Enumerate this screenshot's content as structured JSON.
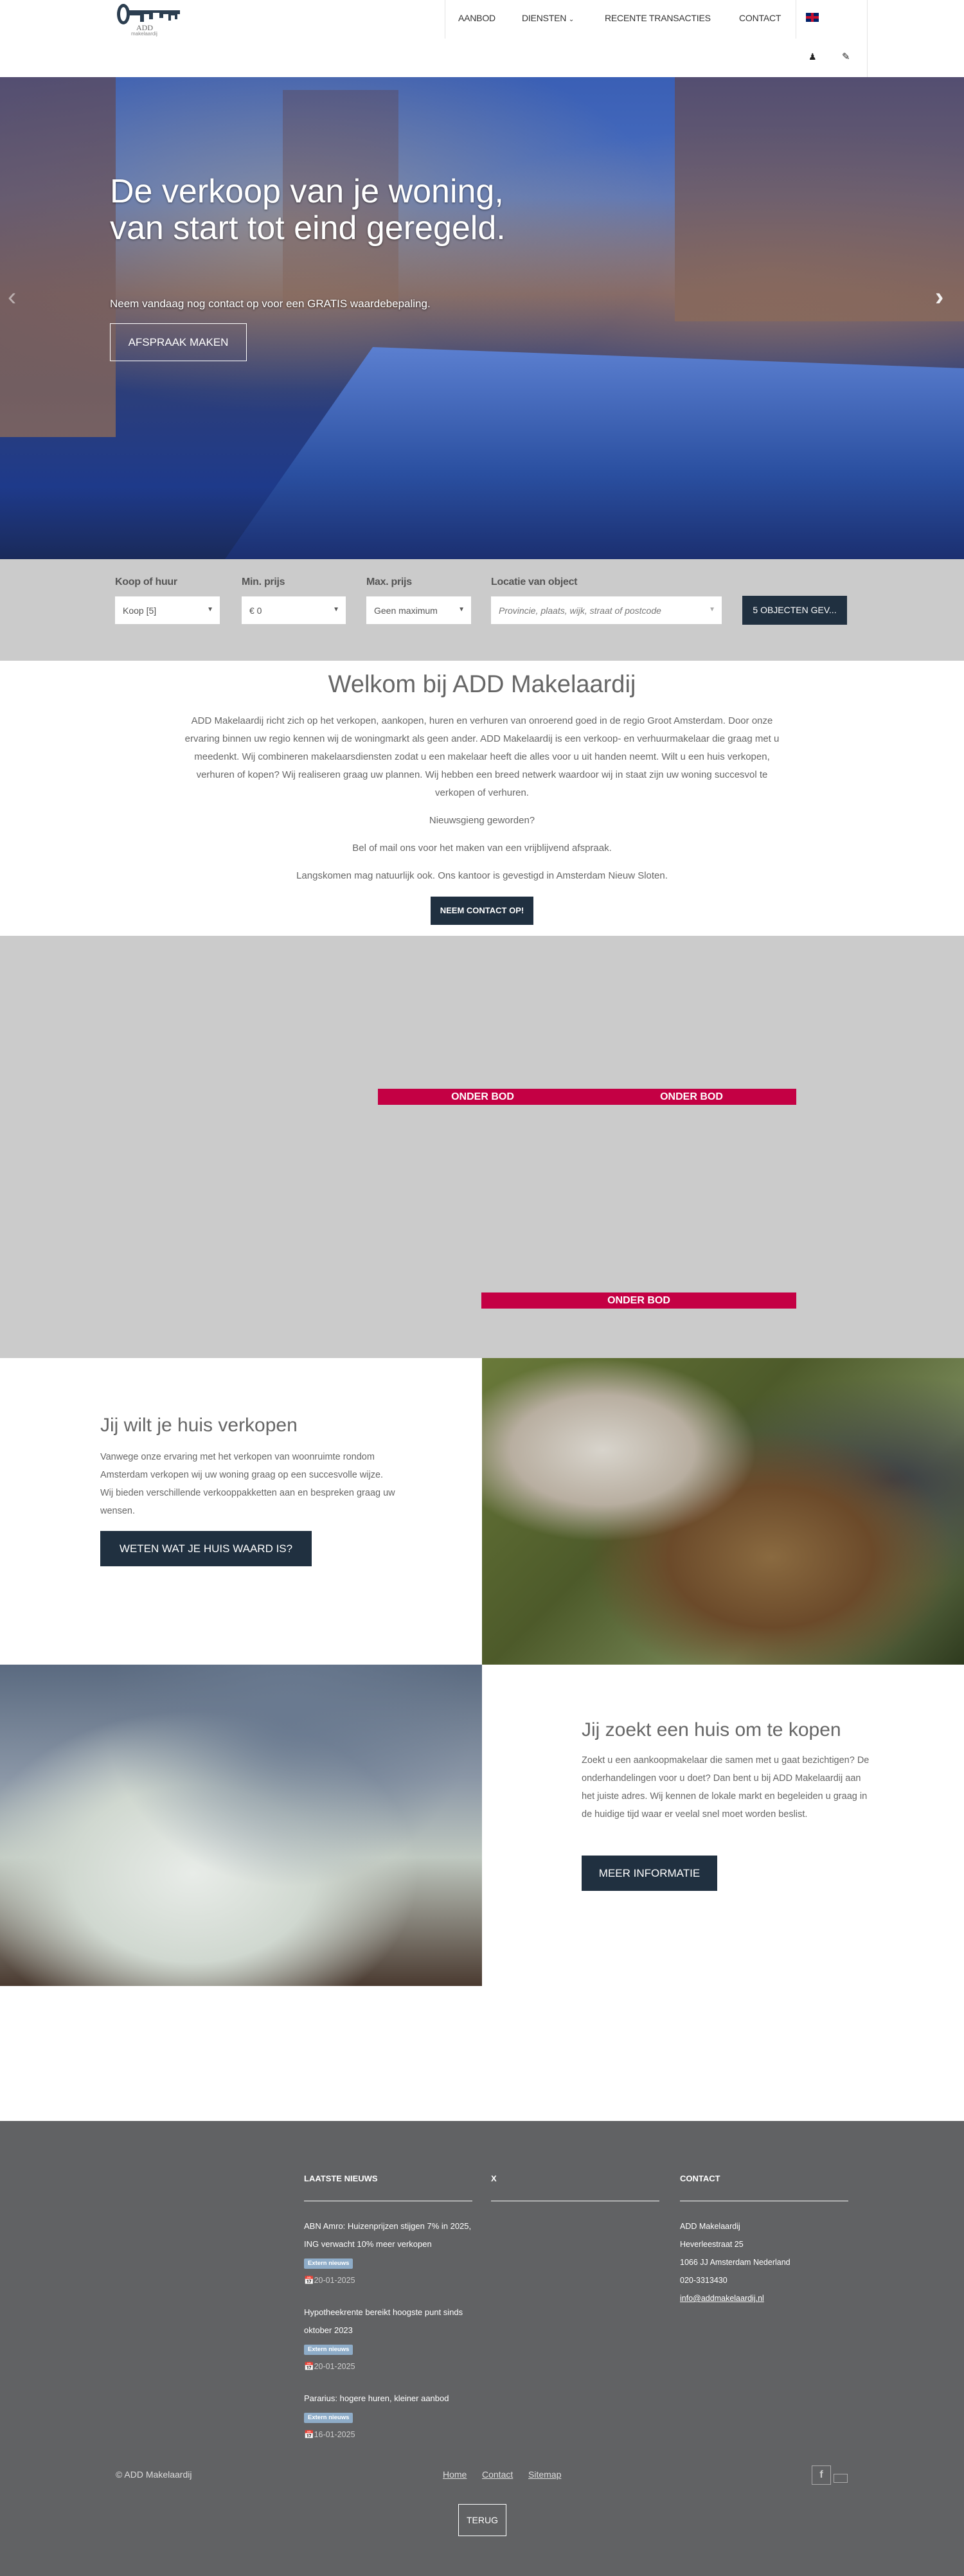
{
  "header": {
    "logo": {
      "text": "ADD",
      "subtext": "makelaardij"
    },
    "nav": [
      {
        "label": "AANBOD"
      },
      {
        "label": "DIENSTEN",
        "icon": "chevron-down-icon"
      },
      {
        "label": "RECENTE TRANSACTIES"
      },
      {
        "label": "CONTACT"
      }
    ],
    "language_icon": "uk-flag-icon",
    "user_icon": "user-icon",
    "edit_icon": "pencil-icon"
  },
  "hero": {
    "title": "De verkoop van je woning, van start tot eind geregeld.",
    "subtitle": "Neem vandaag nog contact op voor een GRATIS waardebepaling.",
    "cta": "AFSPRAAK MAKEN",
    "prev_icon": "chevron-left-icon",
    "next_icon": "chevron-right-icon"
  },
  "search": {
    "fields": [
      {
        "label": "Koop of huur",
        "value": "Koop [5]"
      },
      {
        "label": "Min. prijs",
        "value": "€ 0"
      },
      {
        "label": "Max. prijs",
        "value": "Geen maximum"
      },
      {
        "label": "Locatie van object",
        "placeholder": "Provincie, plaats, wijk, straat of postcode"
      }
    ],
    "submit": "5 OBJECTEN GEV..."
  },
  "welcome": {
    "title": "Welkom bij ADD Makelaardij",
    "paragraphs": [
      "ADD Makelaardij richt zich op het verkopen, aankopen, huren en verhuren van onroerend goed in de regio Groot Amsterdam. Door onze ervaring binnen uw regio kennen wij de woningmarkt als geen ander. ADD Makelaardij is een verkoop- en verhuurmakelaar die graag met u meedenkt. Wij combineren makelaarsdiensten zodat u een makelaar heeft die alles voor u uit handen neemt. Wilt u een huis verkopen, verhuren of kopen? Wij realiseren graag uw plannen. Wij hebben een breed netwerk waardoor wij in staat zijn uw woning succesvol te verkopen of verhuren.",
      "Nieuwsgieng geworden?",
      "Bel of mail ons voor het maken van een vrijblijvend afspraak.",
      "Langskomen mag natuurlijk ook. Ons kantoor is gevestigd in Amsterdam Nieuw Sloten."
    ],
    "button": "NEEM CONTACT OP!"
  },
  "listings": {
    "badges": [
      "ONDER BOD",
      "ONDER BOD",
      "ONDER BOD"
    ],
    "badge_color": "#c40044"
  },
  "sell": {
    "title": "Jij wilt je huis verkopen",
    "text": "Vanwege onze ervaring met het verkopen van woonruimte rondom Amsterdam verkopen wij uw woning graag op een succesvolle wijze. Wij bieden verschillende verkooppakketten aan en bespreken graag uw wensen.",
    "button": "WETEN WAT JE HUIS WAARD IS?"
  },
  "buy": {
    "title": "Jij zoekt een huis om te kopen",
    "text": "Zoekt u een aankoopmakelaar die samen met u gaat bezichtigen? De onderhandelingen voor u doet? Dan bent u bij ADD Makelaardij aan het juiste adres. Wij kennen de lokale markt en begeleiden u graag in de huidige tijd waar er veelal snel moet worden beslist.",
    "button": "MEER INFORMATIE"
  },
  "footer": {
    "news_title": "LAATSTE NIEUWS",
    "news": [
      {
        "title": "ABN Amro: Huizenprijzen stijgen 7% in 2025, ING verwacht 10% meer verkopen",
        "tag": "Extern nieuws",
        "date": "20-01-2025"
      },
      {
        "title": "Hypotheekrente bereikt hoogste punt sinds oktober 2023",
        "tag": "Extern nieuws",
        "date": "20-01-2025"
      },
      {
        "title": "Pararius: hogere huren, kleiner aanbod",
        "tag": "Extern nieuws",
        "date": "16-01-2025"
      }
    ],
    "x_title": "X",
    "contact_title": "CONTACT",
    "contact": {
      "name": "ADD Makelaardij",
      "street": "Heverleestraat 25",
      "city": "1066 JJ Amsterdam Nederland",
      "phone": "020-3313430",
      "email": "info@addmakelaardij.nl"
    },
    "copyright": "© ADD Makelaardij",
    "links": [
      "Home",
      "Contact",
      "Sitemap"
    ],
    "social_icon": "facebook-icon",
    "back": "TERUG"
  },
  "colors": {
    "primary": "#203040",
    "footer_bg": "#616264",
    "search_bg": "#cbcbcb"
  }
}
